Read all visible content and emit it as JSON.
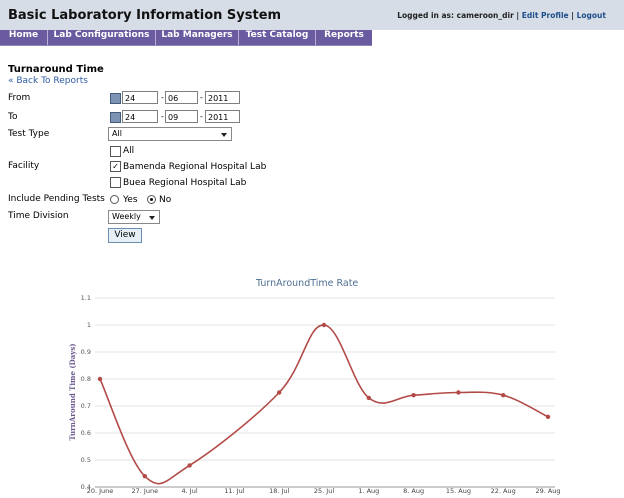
{
  "app": {
    "title": "Basic Laboratory Information System"
  },
  "user": {
    "logged_in_text": "Logged in as: cameroon_dir",
    "sep1": "|",
    "edit_profile": "Edit Profile",
    "sep2": "|",
    "logout": "Logout"
  },
  "nav": {
    "items": [
      "Home",
      "Lab Configurations",
      "Lab Managers",
      "Test Catalog",
      "Reports"
    ]
  },
  "page": {
    "title": "Turnaround Time",
    "back": "« Back To Reports"
  },
  "form": {
    "from_label": "From",
    "to_label": "To",
    "from": {
      "day": "24",
      "month": "06",
      "year": "2011"
    },
    "to": {
      "day": "24",
      "month": "09",
      "year": "2011"
    },
    "test_type_label": "Test Type",
    "test_type_value": "All",
    "facility_label": "Facility",
    "facility_options": [
      {
        "label": "All",
        "checked": false
      },
      {
        "label": "Bamenda Regional Hospital Lab",
        "checked": true
      },
      {
        "label": "Buea Regional Hospital Lab",
        "checked": false
      }
    ],
    "pending_label": "Include Pending Tests",
    "pending_yes": "Yes",
    "pending_no": "No",
    "pending_selected": "No",
    "time_division_label": "Time Division",
    "time_division_value": "Weekly",
    "view_button": "View"
  },
  "colors": {
    "nav_bg": "#6a5aa0",
    "topbar_bg": "#d6dde6",
    "series_color": "#b24a47",
    "link": "#2c5ba3"
  },
  "chart_data": {
    "type": "line",
    "title": "TurnAroundTime Rate",
    "ylabel": "TurnAround Time (Days)",
    "xlabel": "",
    "categories": [
      "20. June",
      "27. June",
      "4. Jul",
      "11. Jul",
      "18. Jul",
      "25. Jul",
      "1. Aug",
      "8. Aug",
      "15. Aug",
      "22. Aug",
      "29. Aug"
    ],
    "ylim": [
      0.4,
      1.1
    ],
    "yticks": [
      "0.4",
      "0.5",
      "0.6",
      "0.7",
      "0.8",
      "0.9",
      "1",
      "1.1"
    ],
    "grid": true,
    "series": [
      {
        "points": [
          [
            "20. June",
            0.8
          ],
          [
            "27. June",
            0.44
          ],
          [
            "4. Jul",
            0.48
          ],
          [
            "18. Jul",
            0.75
          ],
          [
            "25. Jul",
            1.0
          ],
          [
            "1. Aug",
            0.73
          ],
          [
            "8. Aug",
            0.74
          ],
          [
            "15. Aug",
            0.75
          ],
          [
            "22. Aug",
            0.74
          ],
          [
            "29. Aug",
            0.66
          ]
        ]
      }
    ]
  }
}
